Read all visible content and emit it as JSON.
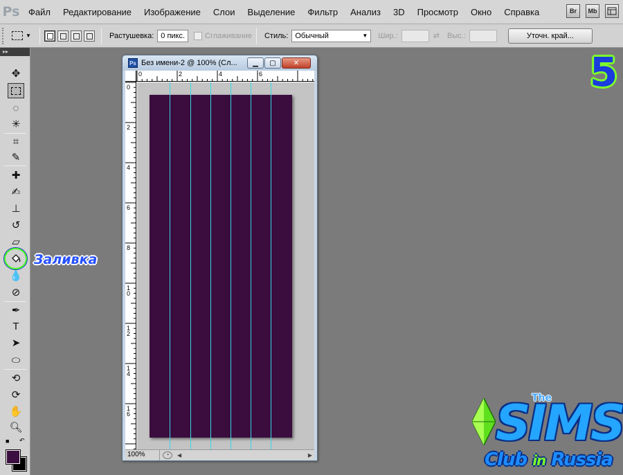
{
  "app": {
    "logo": "Ps"
  },
  "menu": {
    "items": [
      "Файл",
      "Редактирование",
      "Изображение",
      "Слои",
      "Выделение",
      "Фильтр",
      "Анализ",
      "3D",
      "Просмотр",
      "Окно",
      "Справка"
    ],
    "right_buttons": [
      "Br",
      "Mb"
    ]
  },
  "options": {
    "feather_label": "Растушевка:",
    "feather_value": "0 пикс.",
    "antialias_label": "Сглаживание",
    "style_label": "Стиль:",
    "style_value": "Обычный",
    "width_label": "Шир.:",
    "height_label": "Выс.:",
    "refine_label": "Уточн. край..."
  },
  "toolbar": {
    "tools": [
      "move",
      "rectangular-marquee",
      "lasso",
      "magic-wand",
      "crop",
      "eyedropper",
      "spot-healing",
      "brush",
      "clone-stamp",
      "history-brush",
      "eraser",
      "paint-bucket",
      "blur",
      "dodge",
      "pen",
      "type",
      "path-selection",
      "ellipse",
      "3d-rotate",
      "3d-orbit",
      "hand",
      "zoom"
    ],
    "foreground_color": "#3b0f3f",
    "background_color": "#000000"
  },
  "annotation": {
    "fill_label": "Заливка",
    "step_number": "5"
  },
  "document": {
    "title": "Без имени-2 @ 100% (Сл...",
    "ps_badge": "Ps",
    "ruler_h": [
      "0",
      "2",
      "4",
      "6"
    ],
    "ruler_v": [
      "0",
      "2",
      "4",
      "6",
      "8",
      "10",
      "12",
      "14",
      "16"
    ],
    "fill_color": "#3b0c3e",
    "guide_color": "#35d8e8",
    "guide_count": 7,
    "zoom": "100%"
  },
  "watermark": {
    "the": "The",
    "sims": "SIMS",
    "club": "Club",
    "in": "in",
    "russia": "Russia"
  }
}
